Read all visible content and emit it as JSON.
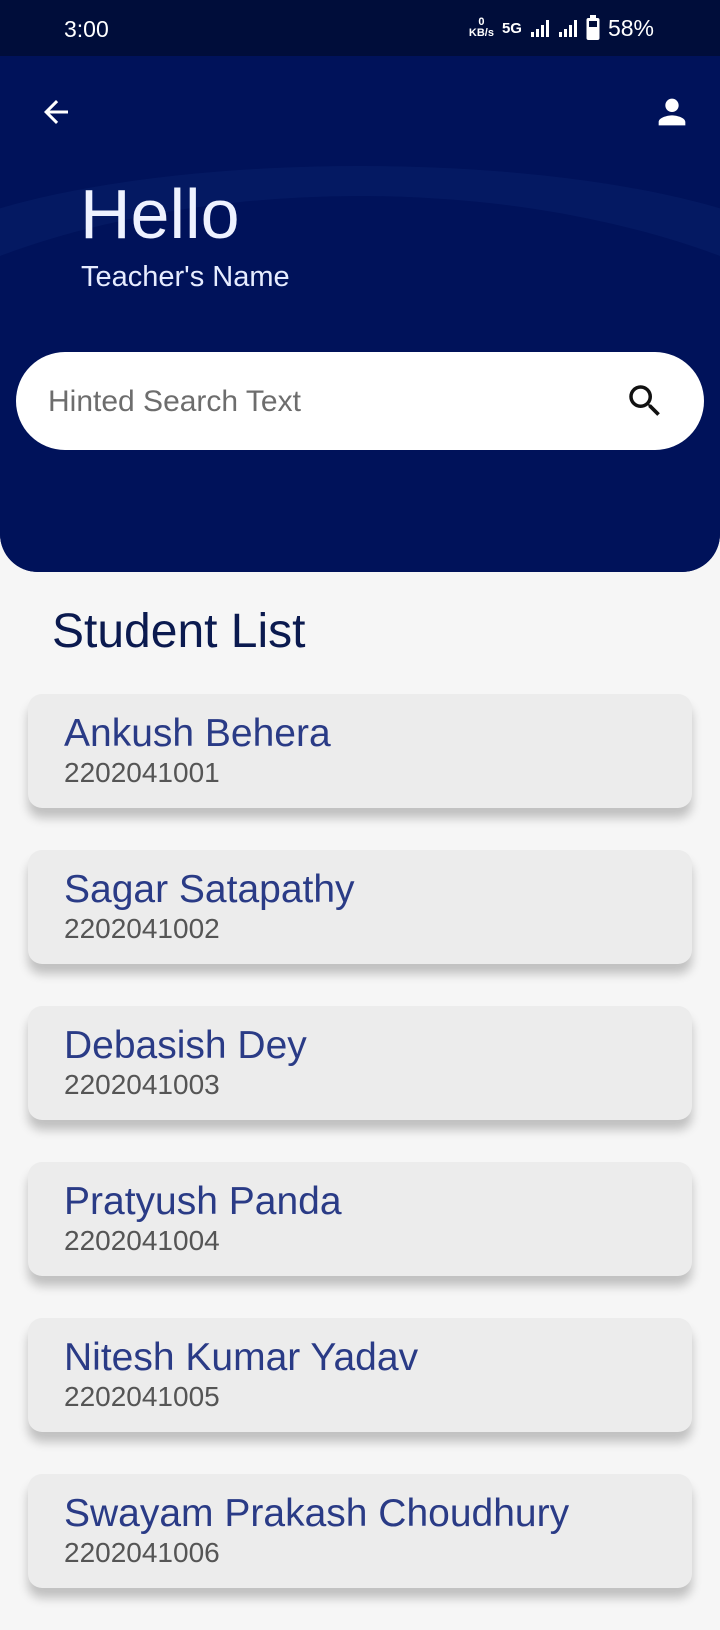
{
  "status_bar": {
    "time": "3:00",
    "speed_value": "0",
    "speed_unit": "KB/s",
    "network": "5G",
    "battery": "58%"
  },
  "header": {
    "back_icon": "arrow-left-icon",
    "profile_icon": "person-icon",
    "greeting": "Hello",
    "subtitle": "Teacher's Name"
  },
  "search": {
    "placeholder": "Hinted Search Text",
    "value": "",
    "icon": "search-icon"
  },
  "student_list": {
    "title": "Student List",
    "students": [
      {
        "name": "Ankush Behera",
        "id": "2202041001"
      },
      {
        "name": "Sagar Satapathy",
        "id": "2202041002"
      },
      {
        "name": "Debasish Dey",
        "id": "2202041003"
      },
      {
        "name": "Pratyush Panda",
        "id": "2202041004"
      },
      {
        "name": "Nitesh Kumar Yadav",
        "id": "2202041005"
      },
      {
        "name": "Swayam Prakash Choudhury",
        "id": "2202041006"
      }
    ]
  },
  "colors": {
    "header_bg": "#00125a",
    "status_bg": "#000d3a",
    "name_text": "#2a3b86",
    "title_text": "#0b1a4f",
    "card_bg": "#ececec"
  }
}
